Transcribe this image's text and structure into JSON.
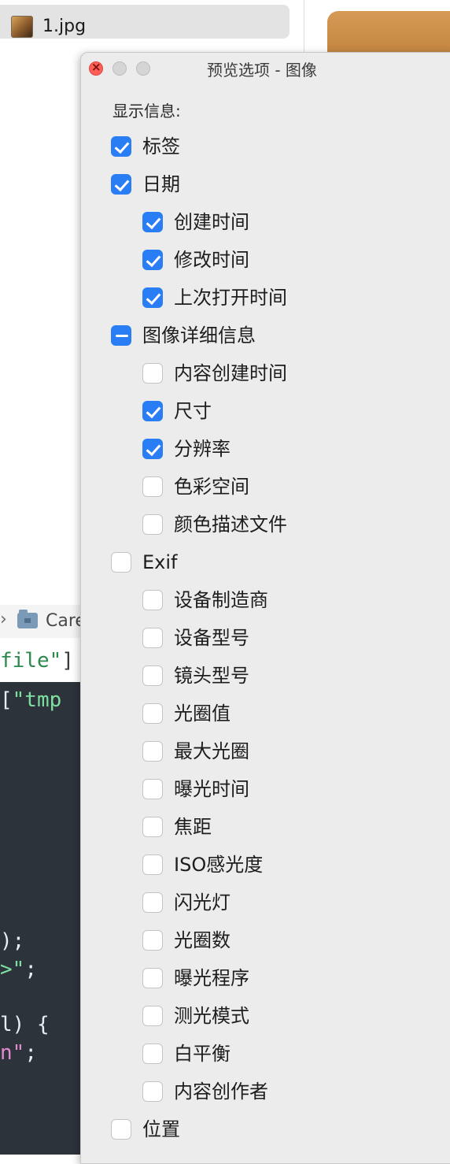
{
  "finder": {
    "file_name": "1.jpg",
    "path_chevron": "›",
    "path_folder": "Care"
  },
  "code_snippets": {
    "line1_text": "file\"",
    "line1_bracket": "]",
    "line2_bracket": "[",
    "line2_string": "\"tmp",
    "line3": ");",
    "line4_string": ">\"",
    "line4_punct": ";",
    "line5": "l) {",
    "line6_string": "n\"",
    "line6_punct": ";"
  },
  "panel": {
    "title": "预览选项 - 图像",
    "section_label": "显示信息:",
    "options": [
      {
        "label": "标签",
        "checked": "on",
        "level": 0
      },
      {
        "label": "日期",
        "checked": "on",
        "level": 0
      },
      {
        "label": "创建时间",
        "checked": "on",
        "level": 1
      },
      {
        "label": "修改时间",
        "checked": "on",
        "level": 1
      },
      {
        "label": "上次打开时间",
        "checked": "on",
        "level": 1
      },
      {
        "label": "图像详细信息",
        "checked": "mixed",
        "level": 0
      },
      {
        "label": "内容创建时间",
        "checked": "off",
        "level": 1
      },
      {
        "label": "尺寸",
        "checked": "on",
        "level": 1
      },
      {
        "label": "分辨率",
        "checked": "on",
        "level": 1
      },
      {
        "label": "色彩空间",
        "checked": "off",
        "level": 1
      },
      {
        "label": "颜色描述文件",
        "checked": "off",
        "level": 1
      },
      {
        "label": "Exif",
        "checked": "off",
        "level": 0
      },
      {
        "label": "设备制造商",
        "checked": "off",
        "level": 1
      },
      {
        "label": "设备型号",
        "checked": "off",
        "level": 1
      },
      {
        "label": "镜头型号",
        "checked": "off",
        "level": 1
      },
      {
        "label": "光圈值",
        "checked": "off",
        "level": 1
      },
      {
        "label": "最大光圈",
        "checked": "off",
        "level": 1
      },
      {
        "label": "曝光时间",
        "checked": "off",
        "level": 1
      },
      {
        "label": "焦距",
        "checked": "off",
        "level": 1
      },
      {
        "label": "ISO感光度",
        "checked": "off",
        "level": 1
      },
      {
        "label": "闪光灯",
        "checked": "off",
        "level": 1
      },
      {
        "label": "光圈数",
        "checked": "off",
        "level": 1
      },
      {
        "label": "曝光程序",
        "checked": "off",
        "level": 1
      },
      {
        "label": "测光模式",
        "checked": "off",
        "level": 1
      },
      {
        "label": "白平衡",
        "checked": "off",
        "level": 1
      },
      {
        "label": "内容创作者",
        "checked": "off",
        "level": 1
      },
      {
        "label": "位置",
        "checked": "off",
        "level": 0
      }
    ]
  },
  "colors": {
    "accent_blue": "#2a7ef5",
    "close_red": "#ff5f57",
    "panel_bg": "#ececec"
  }
}
